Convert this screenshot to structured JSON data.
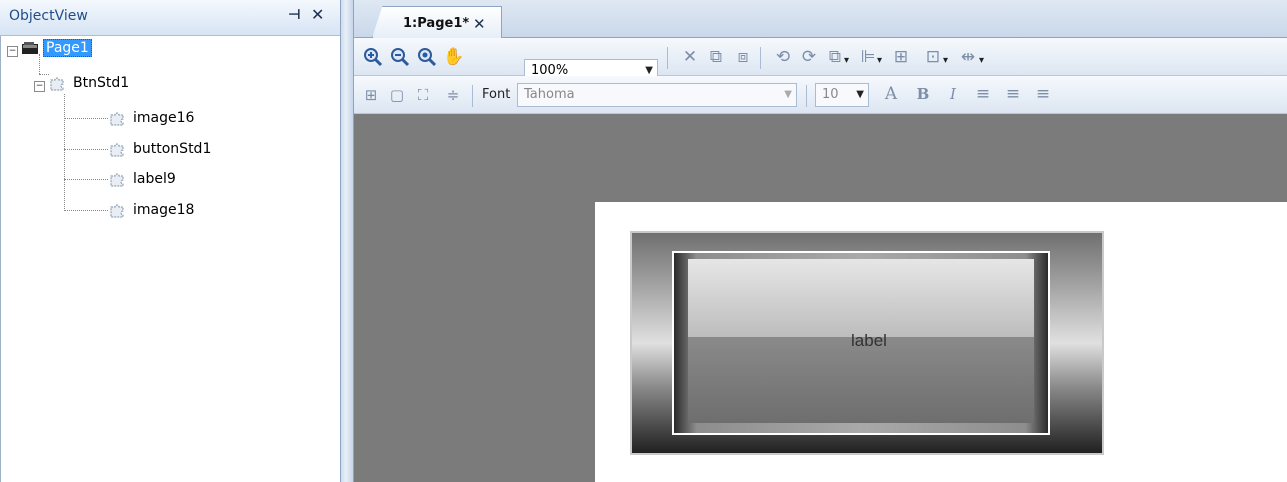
{
  "objectview": {
    "title": "ObjectView",
    "pin_glyph": "⊣",
    "close_glyph": "✕",
    "tree": {
      "root": {
        "label": "Page1",
        "icon": "page-icon",
        "expander": "−"
      },
      "group": {
        "label": "BtnStd1",
        "icon": "puzzle-icon",
        "expander": "−"
      },
      "children": [
        {
          "label": "image16",
          "icon": "puzzle-icon"
        },
        {
          "label": "buttonStd1",
          "icon": "puzzle-icon"
        },
        {
          "label": "label9",
          "icon": "puzzle-icon"
        },
        {
          "label": "image18",
          "icon": "puzzle-icon"
        }
      ]
    }
  },
  "editor": {
    "tab": {
      "label": "1:Page1*",
      "close_glyph": "✕"
    },
    "toolbar1": {
      "zoom_value": "100%",
      "icons": [
        "zoom-in-icon",
        "zoom-out-icon",
        "zoom-fit-icon",
        "hand-pan-icon",
        "delete-icon",
        "group-icon",
        "ungroup-icon",
        "bring-forward-icon",
        "send-backward-icon",
        "order-icon",
        "align-icon",
        "size-icon",
        "spacing-icon",
        "distribute-icon"
      ]
    },
    "toolbar2": {
      "font_label": "Font",
      "font_value": "Tahoma",
      "font_size": "10",
      "icons": [
        "grid-icon",
        "frame-icon",
        "fill-icon",
        "center-icon",
        "font-color-icon",
        "bold-icon",
        "italic-icon",
        "align-left-icon",
        "align-center-icon",
        "align-right-icon"
      ]
    },
    "canvas": {
      "widget_label": "label"
    }
  },
  "colors": {
    "selection": "#3399ff",
    "editor_background": "#7b7b7b",
    "header_text": "#1f4d8a"
  }
}
